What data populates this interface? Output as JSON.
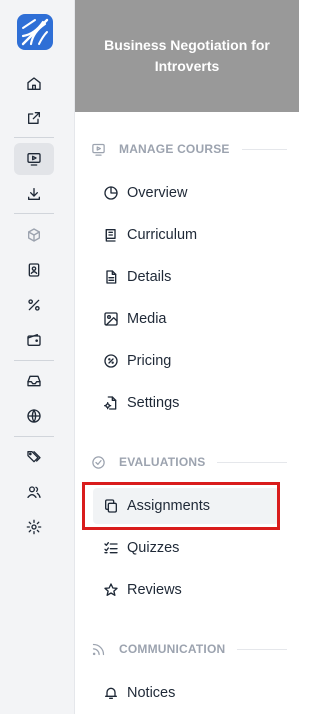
{
  "course": {
    "title": "Business Negotiation for Introverts"
  },
  "sections": {
    "manage": {
      "label": "MANAGE COURSE",
      "items": [
        {
          "label": "Overview",
          "icon": "pie-chart-icon"
        },
        {
          "label": "Curriculum",
          "icon": "book-icon"
        },
        {
          "label": "Details",
          "icon": "file-text-icon"
        },
        {
          "label": "Media",
          "icon": "image-icon"
        },
        {
          "label": "Pricing",
          "icon": "tag-badge-icon"
        },
        {
          "label": "Settings",
          "icon": "file-settings-icon"
        }
      ]
    },
    "evaluations": {
      "label": "EVALUATIONS",
      "items": [
        {
          "label": "Assignments",
          "icon": "copy-icon",
          "selected": true
        },
        {
          "label": "Quizzes",
          "icon": "list-check-icon"
        },
        {
          "label": "Reviews",
          "icon": "star-icon"
        }
      ]
    },
    "communication": {
      "label": "COMMUNICATION",
      "items": [
        {
          "label": "Notices",
          "icon": "bell-icon"
        }
      ]
    }
  },
  "rail": {
    "icons": [
      "home-icon",
      "external-link-icon",
      "monitor-play-icon",
      "download-icon",
      "package-icon",
      "contact-card-icon",
      "percent-icon",
      "wallet-icon",
      "inbox-icon",
      "globe-icon",
      "tags-icon",
      "users-icon",
      "gear-icon"
    ],
    "active": "monitor-play-icon"
  },
  "colors": {
    "accent": "#2f6fd6",
    "highlight": "#d91c1c",
    "header_bg": "#999999"
  }
}
